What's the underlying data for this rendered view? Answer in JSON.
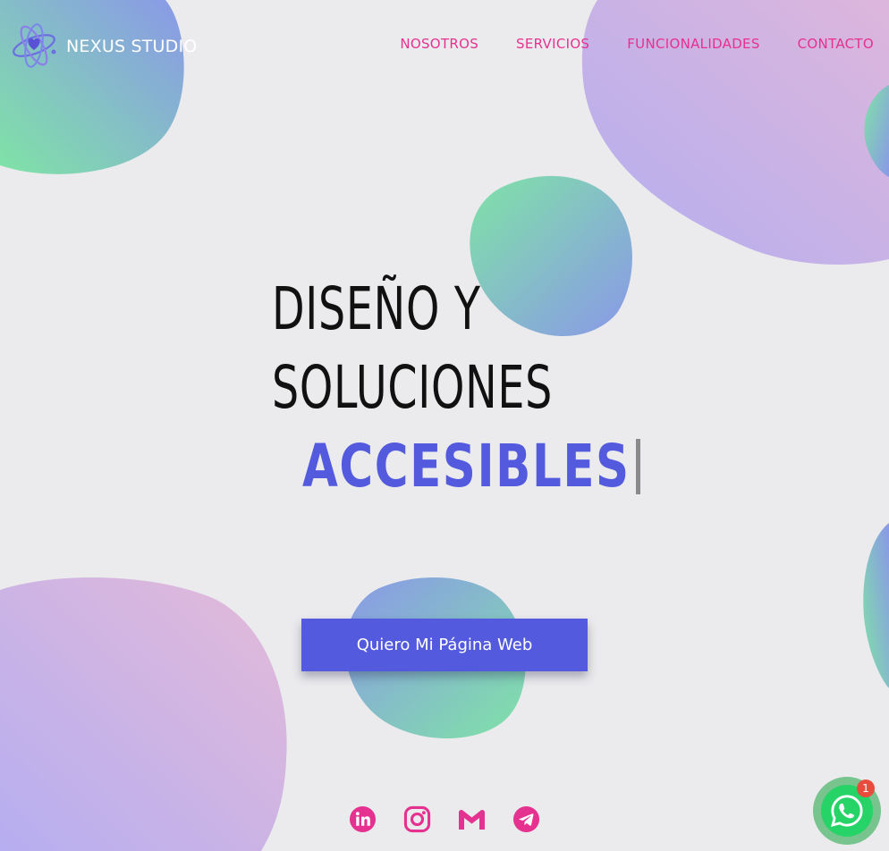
{
  "brand": {
    "name": "NEXUS STUDIO",
    "logo_icon": "atom-heart-icon"
  },
  "nav": {
    "items": [
      {
        "label": "NOSOTROS"
      },
      {
        "label": "SERVICIOS"
      },
      {
        "label": "FUNCIONALIDADES"
      },
      {
        "label": "CONTACTO"
      }
    ]
  },
  "hero": {
    "line1": "DISEÑO Y",
    "line2": "SOLUCIONES",
    "accent": "ACCESIBLES"
  },
  "cta": {
    "label": "Quiero Mi Página Web"
  },
  "social": {
    "icons": [
      "linkedin-icon",
      "instagram-icon",
      "gmail-icon",
      "telegram-icon"
    ]
  },
  "whatsapp": {
    "badge": "1",
    "icon": "whatsapp-icon"
  },
  "colors": {
    "background": "#ebebee",
    "accent_blue": "#535ade",
    "nav_pink": "#e5318f",
    "whatsapp_green": "#25d366",
    "badge_red": "#e74c3c"
  }
}
